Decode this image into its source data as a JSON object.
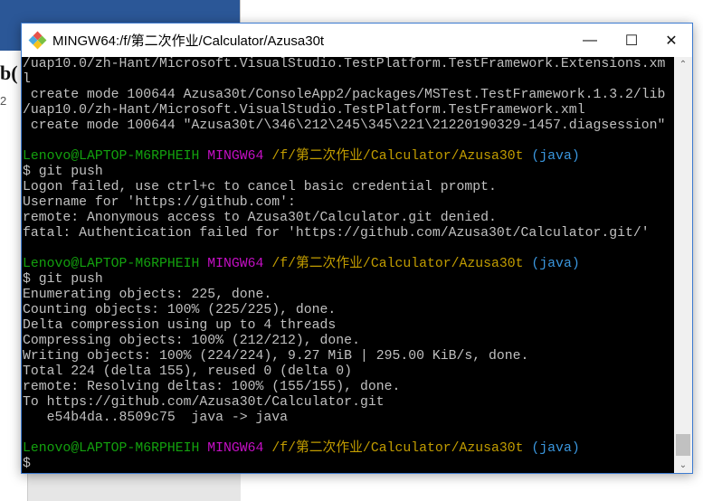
{
  "window": {
    "title": "MINGW64:/f/第二次作业/Calculator/Azusa30t",
    "controls": {
      "minimize": "—",
      "maximize": "☐",
      "close": "✕"
    }
  },
  "background": {
    "fragment1": "b(",
    "fragment2": "2"
  },
  "colors": {
    "user_host": "#13a10e",
    "shell": "#c50fc5",
    "path": "#c19c00",
    "branch": "#3a96dd",
    "text": "#c0c0c0"
  },
  "terminal": {
    "lines": [
      "/uap10.0/zh-Hant/Microsoft.VisualStudio.TestPlatform.TestFramework.Extensions.xm",
      "l",
      " create mode 100644 Azusa30t/ConsoleApp2/packages/MSTest.TestFramework.1.3.2/lib",
      "/uap10.0/zh-Hant/Microsoft.VisualStudio.TestPlatform.TestFramework.xml",
      " create mode 100644 \"Azusa30t/\\346\\212\\245\\345\\221\\21220190329-1457.diagsession\"",
      "",
      {
        "prompt": true
      },
      "$ git push",
      "Logon failed, use ctrl+c to cancel basic credential prompt.",
      "Username for 'https://github.com':",
      "remote: Anonymous access to Azusa30t/Calculator.git denied.",
      "fatal: Authentication failed for 'https://github.com/Azusa30t/Calculator.git/'",
      "",
      {
        "prompt": true
      },
      "$ git push",
      "Enumerating objects: 225, done.",
      "Counting objects: 100% (225/225), done.",
      "Delta compression using up to 4 threads",
      "Compressing objects: 100% (212/212), done.",
      "Writing objects: 100% (224/224), 9.27 MiB | 295.00 KiB/s, done.",
      "Total 224 (delta 155), reused 0 (delta 0)",
      "remote: Resolving deltas: 100% (155/155), done.",
      "To https://github.com/Azusa30t/Calculator.git",
      "   e54b4da..8509c75  java -> java",
      "",
      {
        "prompt": true
      },
      "$"
    ],
    "prompt": {
      "user_host": "Lenovo@LAPTOP-M6RPHEIH",
      "shell": "MINGW64",
      "path": "/f/第二次作业/Calculator/Azusa30t",
      "branch": "(java)"
    }
  },
  "scrollbar": {
    "up": "⌃",
    "down": "⌄",
    "position_percent": 100
  }
}
